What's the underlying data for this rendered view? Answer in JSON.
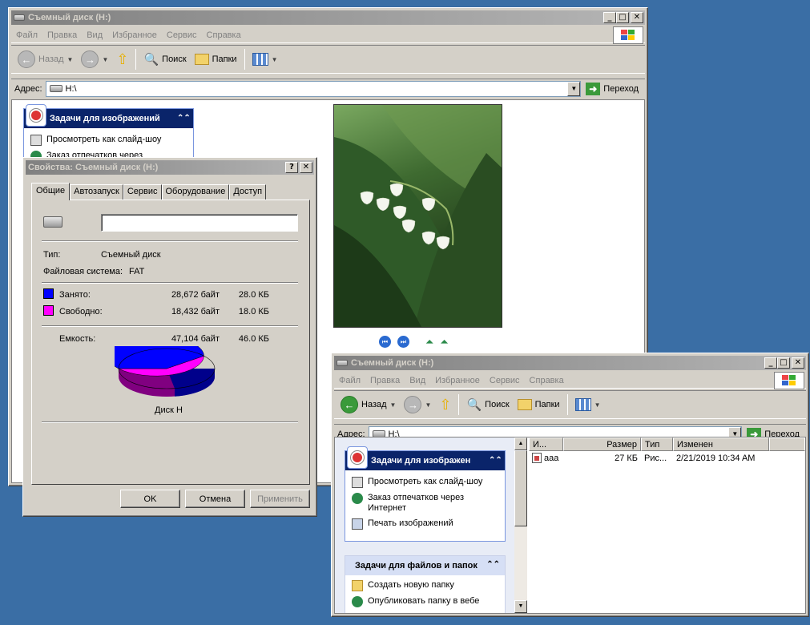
{
  "back_window": {
    "title": "Съемный диск (H:)",
    "menu": [
      "Файл",
      "Правка",
      "Вид",
      "Избранное",
      "Сервис",
      "Справка"
    ],
    "toolbar": {
      "back": "Назад",
      "search": "Поиск",
      "folders": "Папки"
    },
    "address": {
      "label": "Адрес:",
      "value": "H:\\",
      "go": "Переход"
    },
    "image_tasks": {
      "title": "Задачи для изображений",
      "items": [
        "Просмотреть как слайд-шоу",
        "Заказ отпечатков через"
      ]
    }
  },
  "dialog": {
    "title": "Свойства: Съемный диск (H:)",
    "help": "?",
    "close": "✕",
    "tabs": [
      "Общие",
      "Автозапуск",
      "Сервис",
      "Оборудование",
      "Доступ"
    ],
    "name_value": "",
    "type_label": "Тип:",
    "type_value": "Съемный диск",
    "fs_label": "Файловая система:",
    "fs_value": "FAT",
    "used_label": "Занято:",
    "used_bytes": "28,672 байт",
    "used_kb": "28.0 КБ",
    "free_label": "Свободно:",
    "free_bytes": "18,432 байт",
    "free_kb": "18.0 КБ",
    "cap_label": "Емкость:",
    "cap_bytes": "47,104 байт",
    "cap_kb": "46.0 КБ",
    "disk_label": "Диск H",
    "used_color": "#0000ff",
    "free_color": "#ff00ff",
    "used_fraction": 0.609,
    "ok": "OK",
    "cancel": "Отмена",
    "apply": "Применить"
  },
  "front_window": {
    "title": "Съемный диск (H:)",
    "menu": [
      "Файл",
      "Правка",
      "Вид",
      "Избранное",
      "Сервис",
      "Справка"
    ],
    "toolbar": {
      "back": "Назад",
      "search": "Поиск",
      "folders": "Папки"
    },
    "address": {
      "label": "Адрес:",
      "value": "H:\\",
      "go": "Переход"
    },
    "image_tasks": {
      "title": "Задачи для изображен",
      "items": [
        "Просмотреть как слайд-шоу",
        "Заказ отпечатков через Интернет",
        "Печать изображений"
      ]
    },
    "file_tasks": {
      "title": "Задачи для файлов и папок",
      "items": [
        "Создать новую папку",
        "Опубликовать папку в вебе"
      ]
    },
    "columns": [
      "И...",
      "Размер",
      "Тип",
      "Изменен"
    ],
    "files": [
      {
        "name": "aaa",
        "size": "27 КБ",
        "type": "Рис...",
        "modified": "2/21/2019 10:34 AM"
      }
    ]
  }
}
